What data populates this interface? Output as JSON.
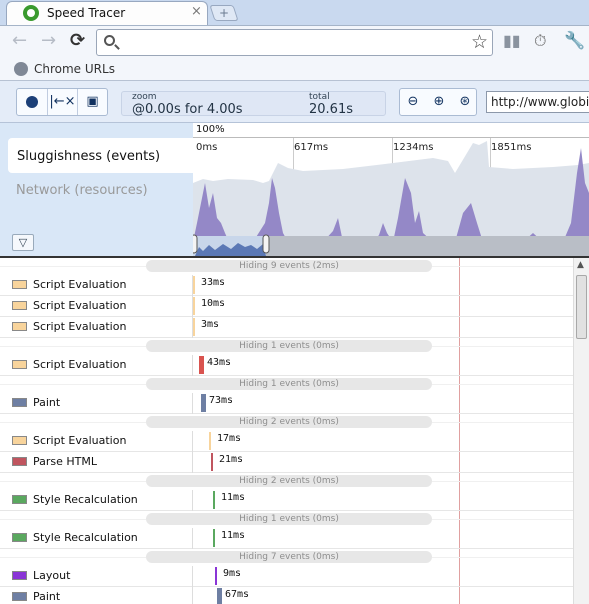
{
  "browser": {
    "tab_title": "Speed Tracer",
    "tab_close": "×",
    "new_tab": "+",
    "bookmark_label": "Chrome URLs",
    "icons": {
      "back": "back-arrow-icon",
      "forward": "forward-arrow-icon",
      "reload": "reload-icon",
      "search": "search-icon",
      "star": "star-icon",
      "page": "page-stats-icon",
      "speedtracer": "speed-tracer-icon",
      "wrench": "wrench-icon"
    }
  },
  "tracer": {
    "zoom_label": "zoom",
    "zoom_value": "@0.00s for 4.00s",
    "total_label": "total",
    "total_value": "20.61s",
    "url_value": "http://www.globin",
    "percent": "100%",
    "sluggishness_label": "Sluggishness (events)",
    "network_label": "Network (resources)",
    "ticks": [
      "0ms",
      "617ms",
      "1234ms",
      "1851ms"
    ]
  },
  "events": [
    {
      "type": "hide",
      "label": "Hiding 9 events (2ms)"
    },
    {
      "type": "event",
      "name": "Script Evaluation",
      "color": "#f8d49c",
      "duration": "33ms",
      "offset": 0
    },
    {
      "type": "event",
      "name": "Script Evaluation",
      "color": "#f8d49c",
      "duration": "10ms",
      "offset": 0
    },
    {
      "type": "event",
      "name": "Script Evaluation",
      "color": "#f8d49c",
      "duration": "3ms",
      "offset": 0
    },
    {
      "type": "hide",
      "label": "Hiding 1 events (0ms)"
    },
    {
      "type": "event",
      "name": "Script Evaluation",
      "color": "#f8d49c",
      "duration": "43ms",
      "offset": 6,
      "bar": "#d9534f"
    },
    {
      "type": "hide",
      "label": "Hiding 1 events (0ms)"
    },
    {
      "type": "event",
      "name": "Paint",
      "color": "#6e7fa3",
      "duration": "73ms",
      "offset": 8,
      "bar": "#6e7fa3"
    },
    {
      "type": "hide",
      "label": "Hiding 2 events (0ms)"
    },
    {
      "type": "event",
      "name": "Script Evaluation",
      "color": "#f8d49c",
      "duration": "17ms",
      "offset": 16
    },
    {
      "type": "event",
      "name": "Parse HTML",
      "color": "#c0555f",
      "duration": "21ms",
      "offset": 18
    },
    {
      "type": "hide",
      "label": "Hiding 2 events (0ms)"
    },
    {
      "type": "event",
      "name": "Style Recalculation",
      "color": "#5aa85f",
      "duration": "11ms",
      "offset": 20
    },
    {
      "type": "hide",
      "label": "Hiding 1 events (0ms)"
    },
    {
      "type": "event",
      "name": "Style Recalculation",
      "color": "#5aa85f",
      "duration": "11ms",
      "offset": 20
    },
    {
      "type": "hide",
      "label": "Hiding 7 events (0ms)"
    },
    {
      "type": "event",
      "name": "Layout",
      "color": "#8a35d6",
      "duration": "9ms",
      "offset": 22
    },
    {
      "type": "event",
      "name": "Paint",
      "color": "#6e7fa3",
      "duration": "67ms",
      "offset": 24,
      "bar": "#6e7fa3"
    }
  ]
}
